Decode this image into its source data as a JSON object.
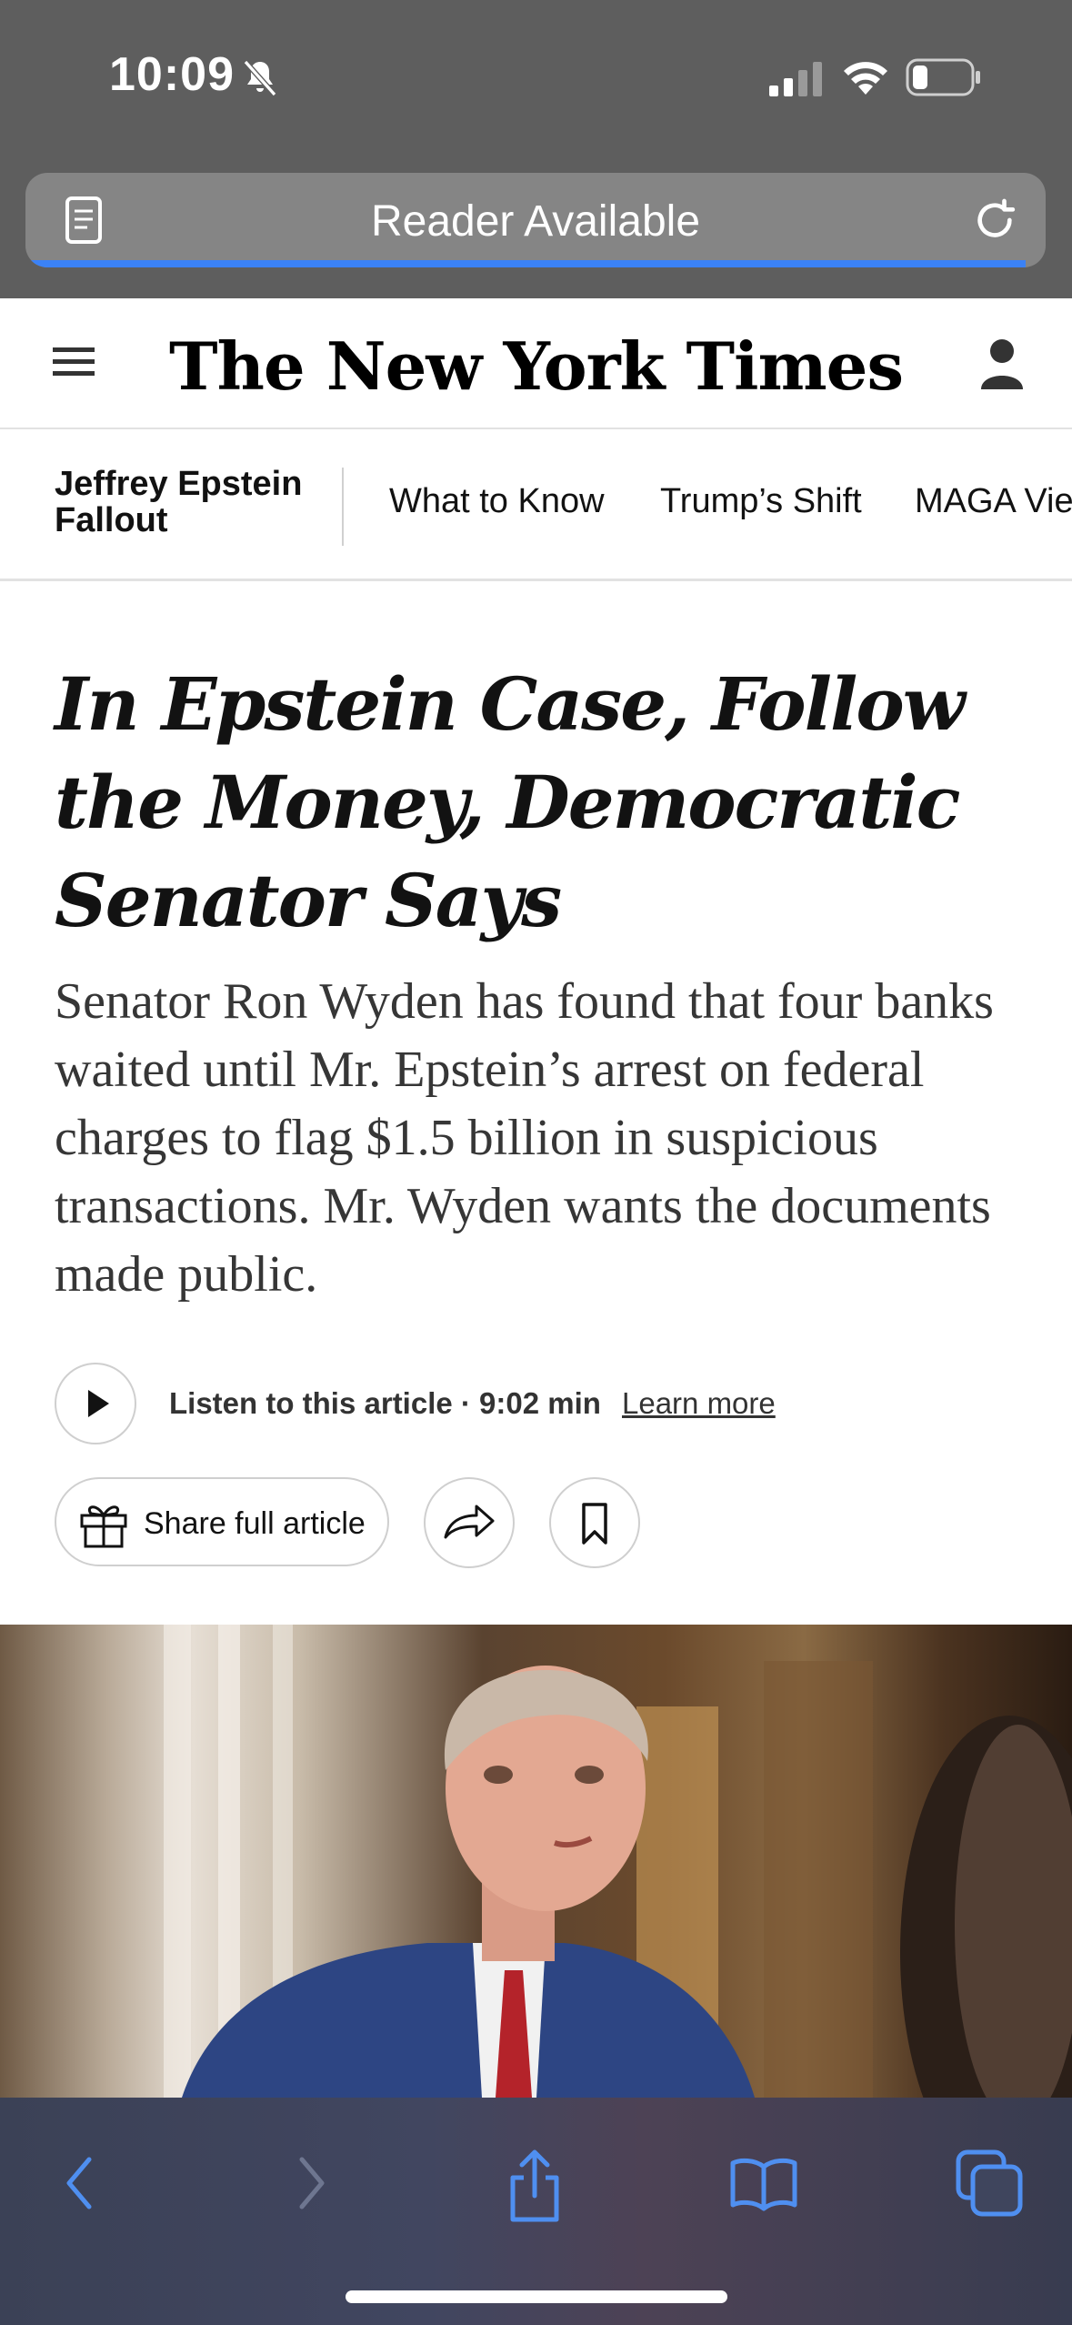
{
  "status_bar": {
    "time": "10:09",
    "icons": [
      "bell-slash-icon",
      "signal-icon",
      "wifi-icon",
      "battery-icon"
    ]
  },
  "browser": {
    "url_label": "Reader Available",
    "load_progress": 0.98,
    "accent_color": "#3b82f6"
  },
  "nyt": {
    "logo": "The New York Times"
  },
  "subnav": {
    "title": "Jeffrey Epstein Fallout",
    "links": [
      "What to Know",
      "Trump’s Shift",
      "MAGA Vie"
    ]
  },
  "article": {
    "headline": "In Epstein Case, Follow the Money, Democratic Senator Says",
    "summary": "Senator Ron Wyden has found that four banks waited until Mr. Epstein’s arrest on federal charges to flag $1.5 billion in suspicious transactions. Mr. Wyden wants the documents made public.",
    "listen_label": "Listen to this article · 9:02 min",
    "learn_more": "Learn more",
    "share_label": "Share full article"
  },
  "toolbar": {
    "icons": [
      "back-icon",
      "forward-icon",
      "share-icon",
      "bookmarks-icon",
      "tabs-icon"
    ]
  }
}
